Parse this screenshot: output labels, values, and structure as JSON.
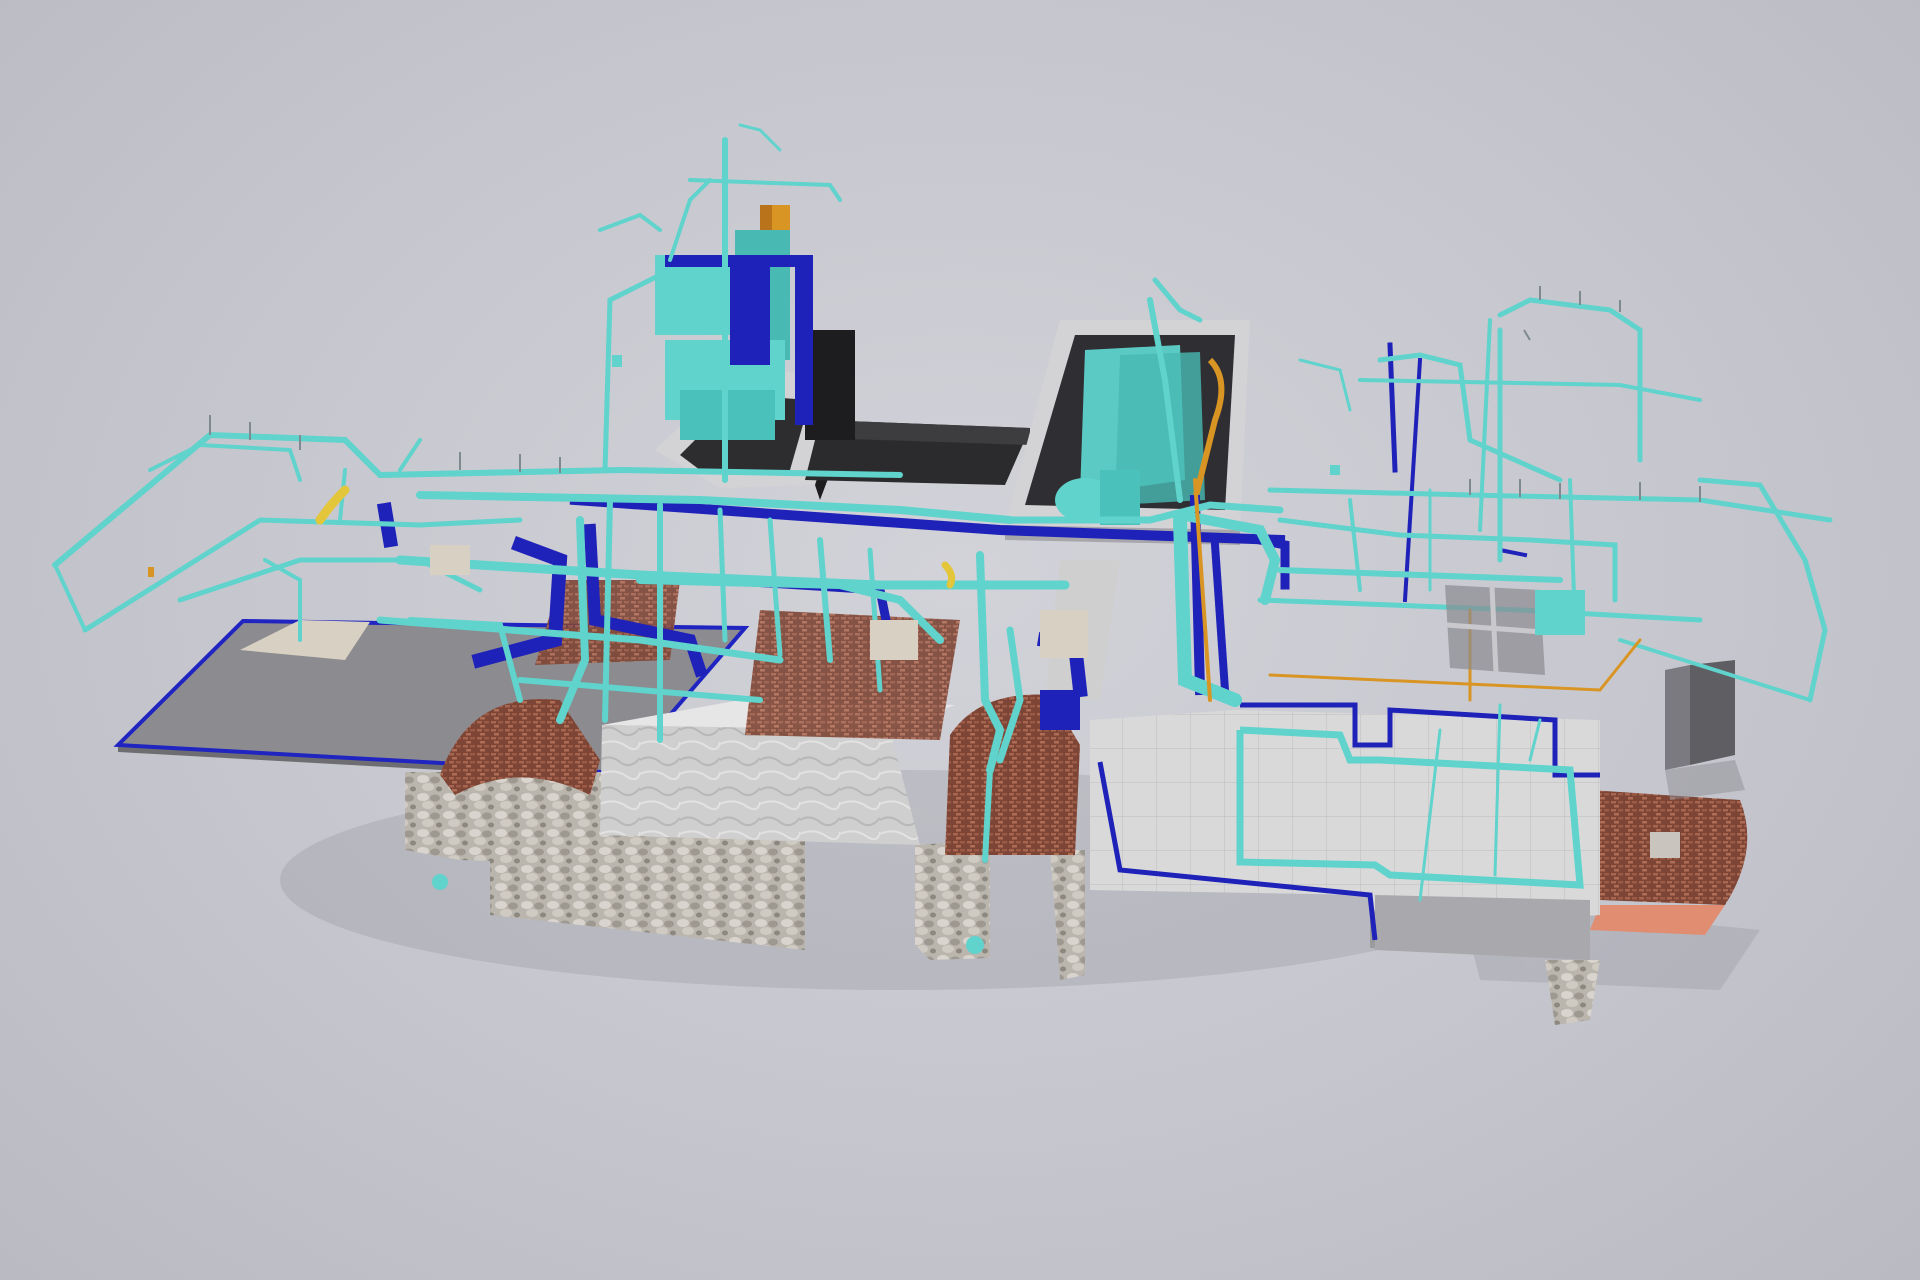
{
  "scene": {
    "kind": "3D building services model render",
    "background_color": "#c6c6ce"
  },
  "colors": {
    "pipe_cyan": "#5fd3cc",
    "pipe_cyan_dark": "#3fa9a3",
    "duct_blue": "#1f22b8",
    "accent_yellow": "#e4c63a",
    "accent_orange": "#d99524",
    "brick": "#8f5440",
    "masonry": "#bdb8b0",
    "floor_grey": "#8a8a8e",
    "floor_light": "#d6d6d6",
    "dark_slab": "#3a3a3a"
  }
}
